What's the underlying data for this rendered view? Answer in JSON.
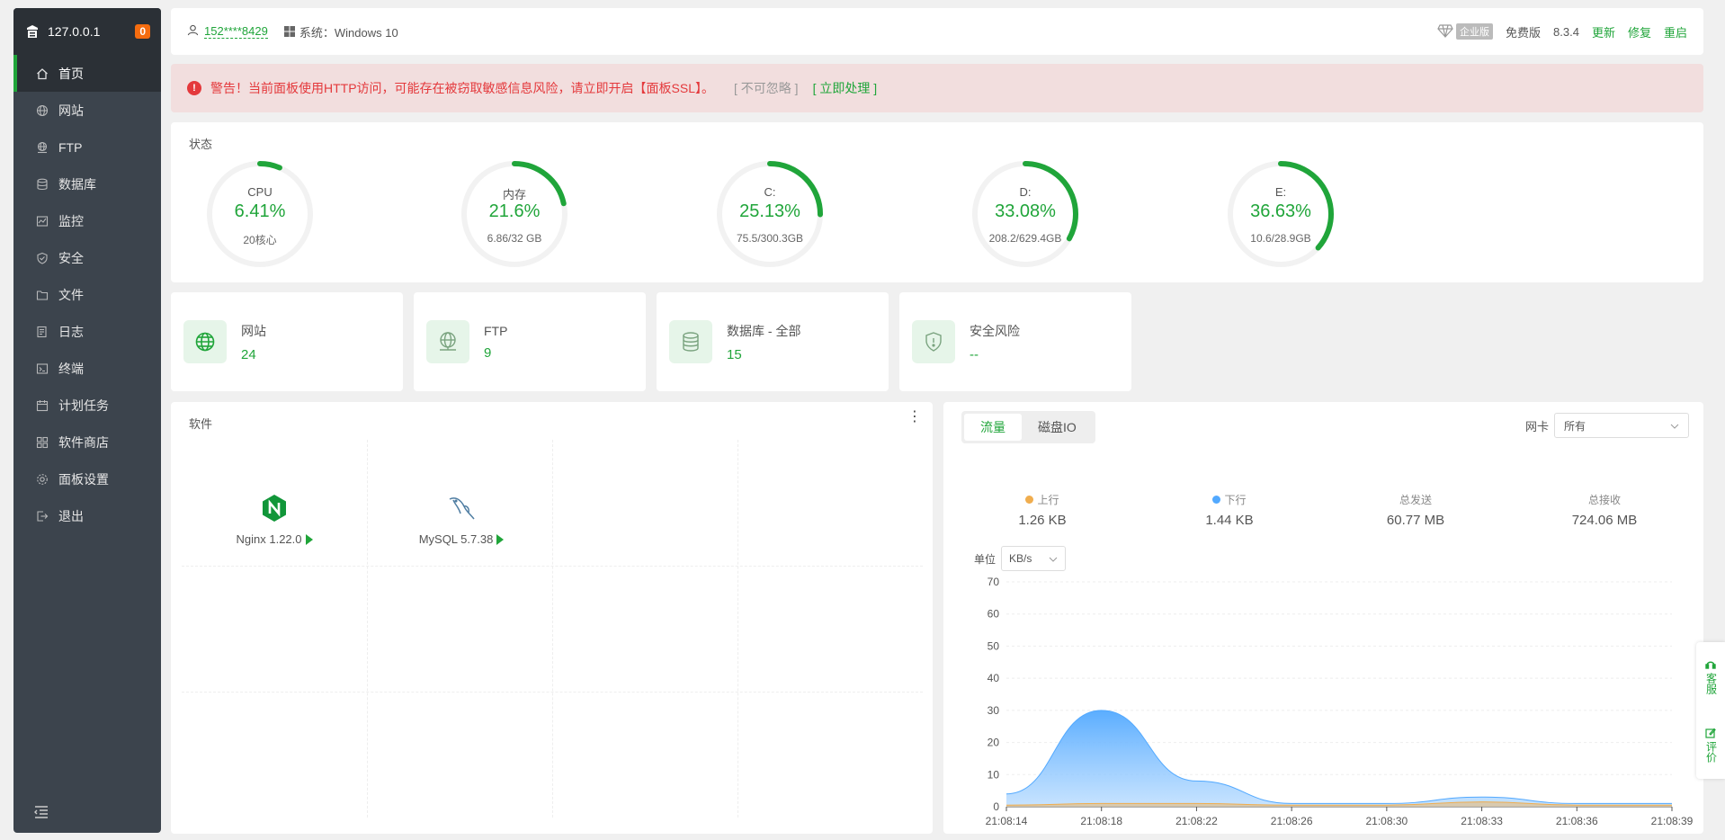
{
  "sidebar": {
    "host": "127.0.0.1",
    "badge": "0",
    "items": [
      {
        "label": "首页",
        "icon": "home-icon"
      },
      {
        "label": "网站",
        "icon": "globe-icon"
      },
      {
        "label": "FTP",
        "icon": "ftp-icon"
      },
      {
        "label": "数据库",
        "icon": "database-icon"
      },
      {
        "label": "监控",
        "icon": "monitor-icon"
      },
      {
        "label": "安全",
        "icon": "shield-icon"
      },
      {
        "label": "文件",
        "icon": "folder-icon"
      },
      {
        "label": "日志",
        "icon": "log-icon"
      },
      {
        "label": "终端",
        "icon": "terminal-icon"
      },
      {
        "label": "计划任务",
        "icon": "calendar-icon"
      },
      {
        "label": "软件商店",
        "icon": "apps-icon"
      },
      {
        "label": "面板设置",
        "icon": "gear-icon"
      },
      {
        "label": "退出",
        "icon": "logout-icon"
      }
    ]
  },
  "topbar": {
    "phone": "152****8429",
    "system": "系统：Windows 10",
    "edition_tag": "企业版",
    "plan": "免费版",
    "version": "8.3.4",
    "update": "更新",
    "repair": "修复",
    "restart": "重启"
  },
  "alert": {
    "message": "警告！当前面板使用HTTP访问，可能存在被窃取敏感信息风险，请立即开启【面板SSL】。",
    "ignore": "[ 不可忽略 ]",
    "action": "[ 立即处理 ]"
  },
  "status": {
    "title": "状态",
    "gauges": [
      {
        "name": "CPU",
        "value": "6.41%",
        "sub": "20核心",
        "pct": 6.41
      },
      {
        "name": "内存",
        "value": "21.6%",
        "sub": "6.86/32 GB",
        "pct": 21.6
      },
      {
        "name": "C:",
        "value": "25.13%",
        "sub": "75.5/300.3GB",
        "pct": 25.13
      },
      {
        "name": "D:",
        "value": "33.08%",
        "sub": "208.2/629.4GB",
        "pct": 33.08
      },
      {
        "name": "E:",
        "value": "36.63%",
        "sub": "10.6/28.9GB",
        "pct": 36.63
      }
    ]
  },
  "stats": [
    {
      "label": "网站",
      "value": "24",
      "icon": "globe-icon"
    },
    {
      "label": "FTP",
      "value": "9",
      "icon": "ftp-icon"
    },
    {
      "label": "数据库 - 全部",
      "value": "15",
      "icon": "database-icon"
    },
    {
      "label": "安全风险",
      "value": "--",
      "icon": "shield-icon"
    }
  ],
  "software": {
    "title": "软件",
    "apps": [
      {
        "name": "Nginx 1.22.0",
        "icon": "nginx-icon"
      },
      {
        "name": "MySQL 5.7.38",
        "icon": "mysql-icon"
      }
    ]
  },
  "traffic": {
    "tabs": [
      "流量",
      "磁盘IO"
    ],
    "nic_label": "网卡",
    "nic_value": "所有",
    "up_label": "上行",
    "up_value": "1.26 KB",
    "down_label": "下行",
    "down_value": "1.44 KB",
    "sent_label": "总发送",
    "sent_value": "60.77 MB",
    "recv_label": "总接收",
    "recv_value": "724.06 MB",
    "unit_label": "单位",
    "unit_value": "KB/s",
    "colors": {
      "up": "#f0ad4e",
      "down": "#52a9ff"
    }
  },
  "chart_data": {
    "type": "area",
    "x": [
      "21:08:14",
      "21:08:18",
      "21:08:22",
      "21:08:26",
      "21:08:30",
      "21:08:33",
      "21:08:36",
      "21:08:39"
    ],
    "series": [
      {
        "name": "下行",
        "values": [
          4,
          30,
          8,
          1,
          1,
          3,
          1,
          1
        ]
      },
      {
        "name": "上行",
        "values": [
          0.5,
          1,
          1,
          0.5,
          0.5,
          1.5,
          0.5,
          0.5
        ]
      }
    ],
    "ylim": [
      0,
      70
    ],
    "yticks": [
      0,
      10,
      20,
      30,
      40,
      50,
      60,
      70
    ]
  },
  "float": {
    "service": "客服",
    "review": "评价"
  }
}
